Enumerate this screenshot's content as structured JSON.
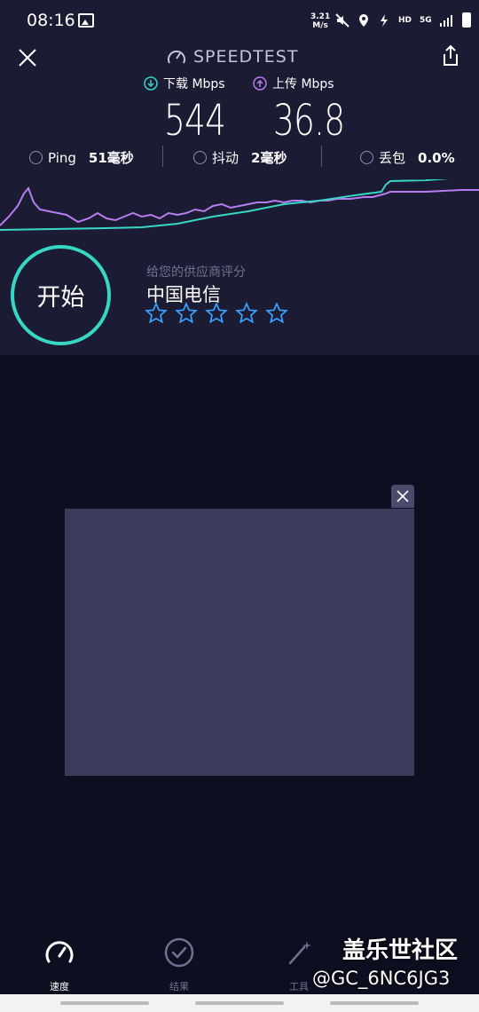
{
  "status_bar": {
    "time": "08:16",
    "net_speed_value": "3.21",
    "net_speed_unit": "M/s",
    "hd_label": "HD",
    "network_label": "5G"
  },
  "header": {
    "title": "SPEEDTEST"
  },
  "download": {
    "label": "下载 Mbps",
    "value": "544",
    "color": "#37d7c6"
  },
  "upload": {
    "label": "上传 Mbps",
    "value": "36.8",
    "color": "#b77cf0"
  },
  "stats": {
    "ping_label": "Ping",
    "ping_value": "51毫秒",
    "jitter_label": "抖动",
    "jitter_value": "2毫秒",
    "loss_label": "丢包",
    "loss_value": "0.0%"
  },
  "start_button": {
    "label": "开始"
  },
  "rating": {
    "prompt": "给您的供应商评分",
    "isp": "中国电信",
    "stars_total": 5,
    "stars_filled": 0,
    "star_color": "#3aa0ff"
  },
  "nav": {
    "items": [
      {
        "label": "速度",
        "icon": "speedometer-icon",
        "active": true
      },
      {
        "label": "结果",
        "icon": "checkmark-circle-icon",
        "active": false
      },
      {
        "label": "工具",
        "icon": "wand-icon",
        "active": false
      }
    ]
  },
  "watermark": {
    "line1": "盖乐世社区",
    "line2": "@GC_6NC6JG3"
  }
}
